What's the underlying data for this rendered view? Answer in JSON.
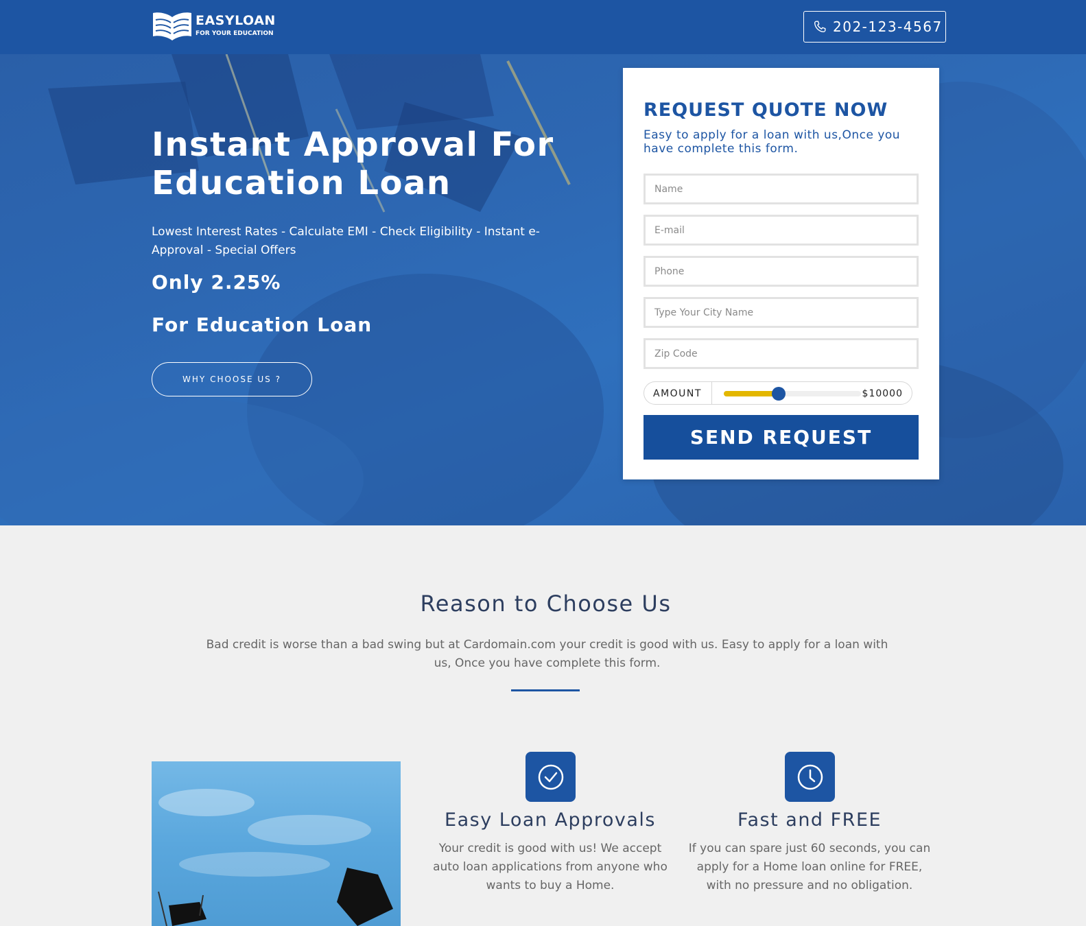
{
  "header": {
    "logo_title": "EASYLOAN",
    "logo_subtitle": "FOR YOUR EDUCATION",
    "phone": "202-123-4567"
  },
  "hero": {
    "title": "Instant Approval For Education Loan",
    "subtitle": "Lowest Interest Rates - Calculate EMI - Check Eligibility - Instant e-Approval - Special Offers",
    "rate": "Only 2.25%",
    "for_text": "For Education Loan",
    "why_button": "WHY CHOOSE US ?"
  },
  "form": {
    "title": "REQUEST QUOTE NOW",
    "description": "Easy to apply for a loan with us,Once you have complete this form.",
    "name_placeholder": "Name",
    "email_placeholder": "E-mail",
    "phone_placeholder": "Phone",
    "city_placeholder": "Type Your City Name",
    "zip_placeholder": "Zip Code",
    "amount_label": "AMOUNT",
    "amount_value": "$10000",
    "slider_fraction": 0.4,
    "submit_label": "SEND REQUEST"
  },
  "reasons": {
    "title": "Reason to Choose Us",
    "description": "Bad credit is worse than a bad swing but at Cardomain.com your credit is good with us. Easy to apply for a loan with us, Once you have complete this form.",
    "features": [
      {
        "icon": "check-circle-icon",
        "title": "Easy Loan Approvals",
        "text": "Your credit is good with us! We accept auto loan applications from anyone who wants to buy a Home."
      },
      {
        "icon": "clock-icon",
        "title": "Fast and FREE",
        "text": "If you can spare just 60 seconds, you can apply for a Home loan online for FREE, with no pressure and no obligation."
      }
    ]
  },
  "colors": {
    "brand_blue": "#1d55a3",
    "slider_yellow": "#e3b700",
    "page_bg": "#f0f0f0"
  }
}
